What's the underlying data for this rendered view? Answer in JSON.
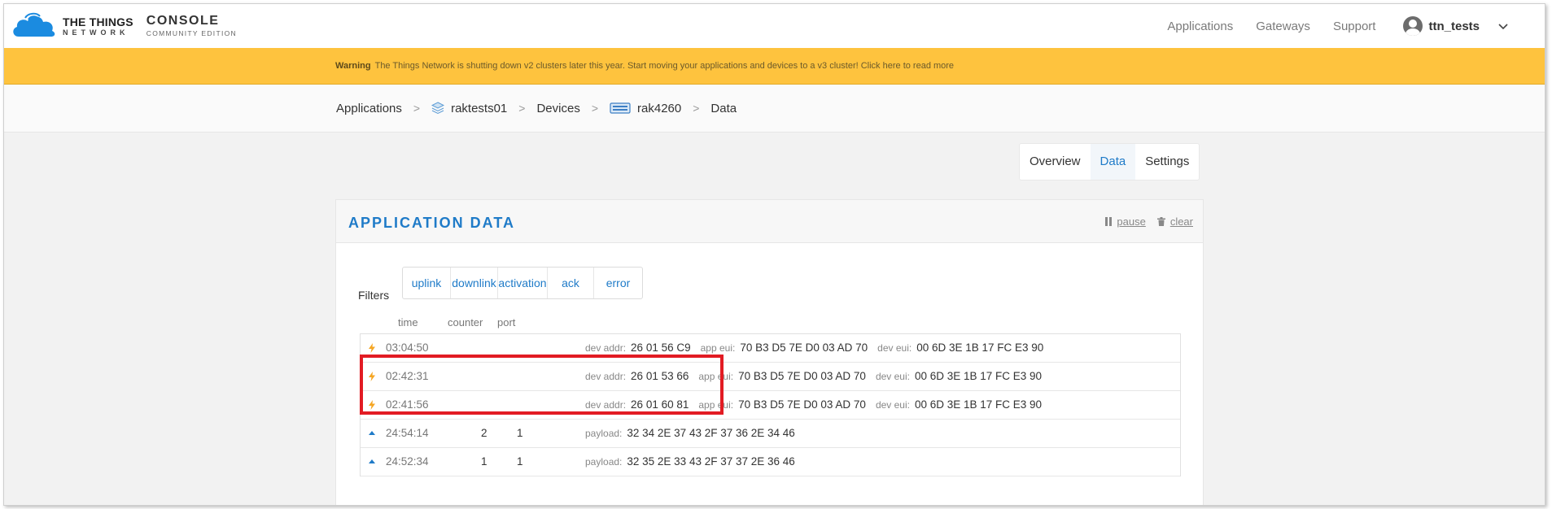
{
  "brand": {
    "ttn_line1": "THE THINGS",
    "ttn_line2": "NETWORK",
    "console_line1": "CONSOLE",
    "console_line2": "COMMUNITY EDITION",
    "cloud_color": "#1b8be0"
  },
  "nav": {
    "links": [
      "Applications",
      "Gateways",
      "Support"
    ],
    "username": "ttn_tests"
  },
  "warning": {
    "label": "Warning",
    "text": "The Things Network is shutting down v2 clusters later this year. Start moving your applications and devices to a v3 cluster! Click here to read more",
    "color": "#fec33e"
  },
  "breadcrumb": {
    "items": [
      "Applications",
      "raktests01",
      "Devices",
      "rak4260",
      "Data"
    ]
  },
  "tabs": [
    "Overview",
    "Data",
    "Settings"
  ],
  "panel": {
    "title": "APPLICATION DATA",
    "pause": "pause",
    "clear": "clear",
    "filters_label": "Filters",
    "filters": [
      "uplink",
      "downlink",
      "activation",
      "ack",
      "error"
    ],
    "columns": {
      "time": "time",
      "counter": "counter",
      "port": "port"
    }
  },
  "rows": [
    {
      "type": "activation",
      "time": "03:04:50",
      "counter": "",
      "port": "",
      "dev_addr_label": "dev addr:",
      "dev_addr": "26 01 56 C9",
      "app_eui_label": "app eui:",
      "app_eui": "70 B3 D5 7E D0 03 AD 70",
      "dev_eui_label": "dev eui:",
      "dev_eui": "00 6D 3E 1B 17 FC E3 90"
    },
    {
      "type": "activation",
      "time": "02:42:31",
      "counter": "",
      "port": "",
      "dev_addr_label": "dev addr:",
      "dev_addr": "26 01 53 66",
      "app_eui_label": "app eui:",
      "app_eui": "70 B3 D5 7E D0 03 AD 70",
      "dev_eui_label": "dev eui:",
      "dev_eui": "00 6D 3E 1B 17 FC E3 90"
    },
    {
      "type": "activation",
      "time": "02:41:56",
      "counter": "",
      "port": "",
      "dev_addr_label": "dev addr:",
      "dev_addr": "26 01 60 81",
      "app_eui_label": "app eui:",
      "app_eui": "70 B3 D5 7E D0 03 AD 70",
      "dev_eui_label": "dev eui:",
      "dev_eui": "00 6D 3E 1B 17 FC E3 90"
    },
    {
      "type": "uplink",
      "time": "24:54:14",
      "counter": "2",
      "port": "1",
      "payload_label": "payload:",
      "payload": "32 34 2E 37 43 2F 37 36 2E 34 46"
    },
    {
      "type": "uplink",
      "time": "24:52:34",
      "counter": "1",
      "port": "1",
      "payload_label": "payload:",
      "payload": "32 35 2E 33 43 2F 37 37 2E 36 46"
    }
  ]
}
